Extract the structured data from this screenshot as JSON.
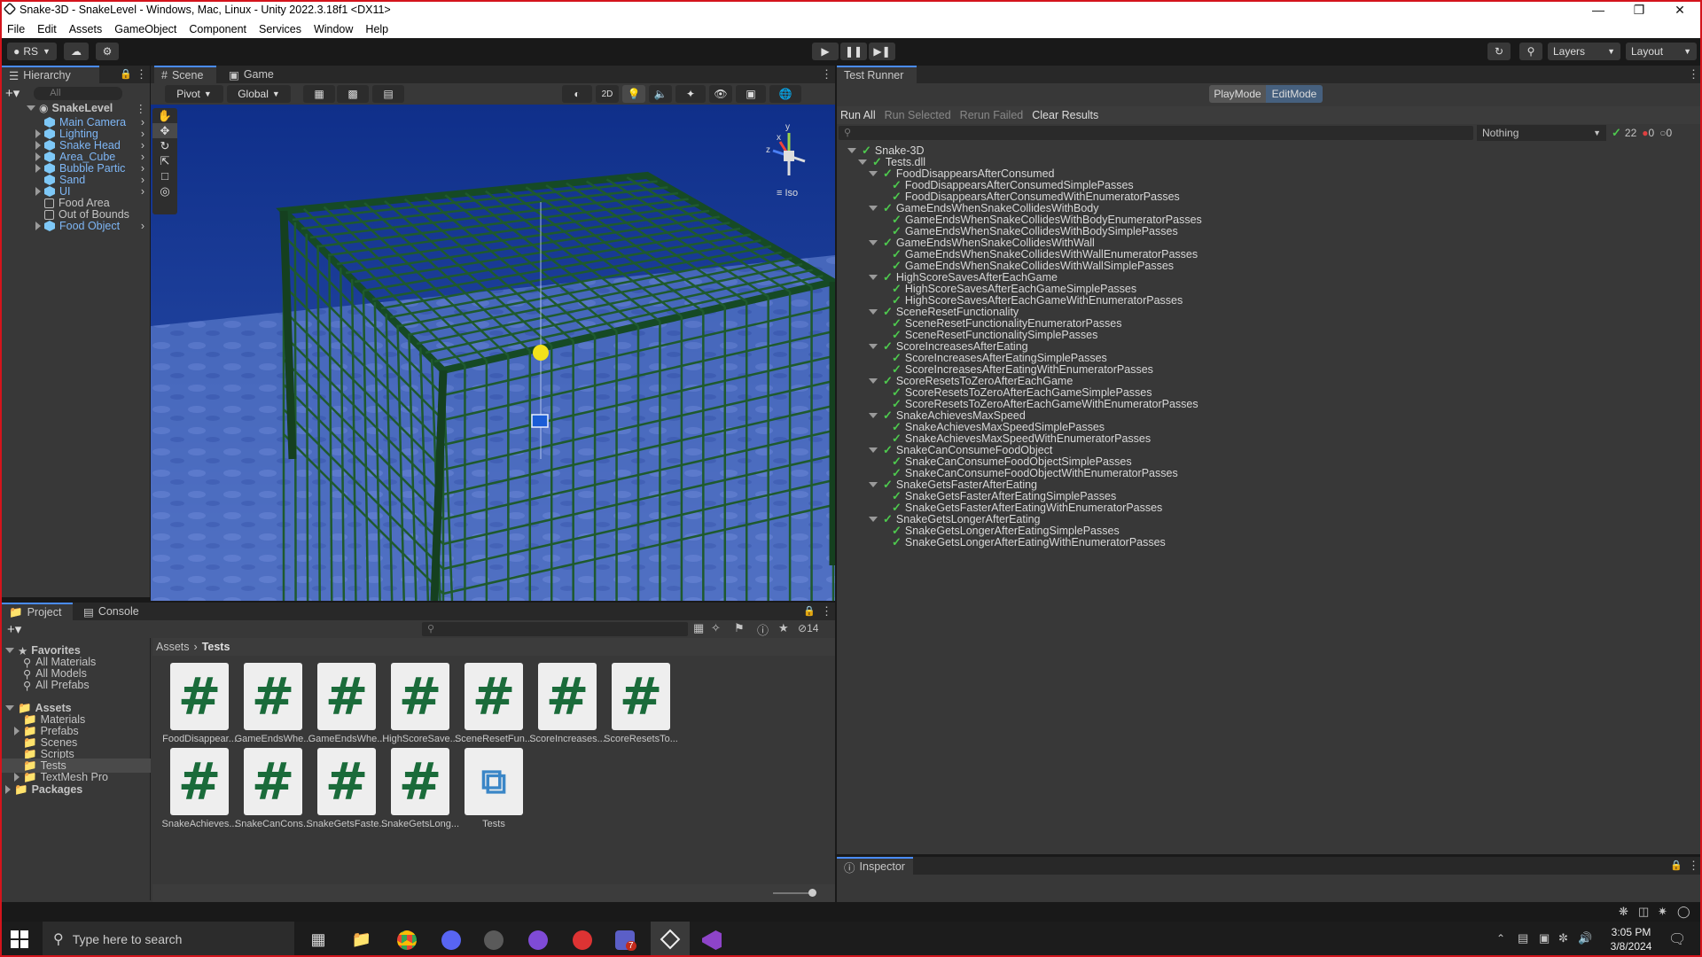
{
  "window": {
    "title": "Snake-3D - SnakeLevel - Windows, Mac, Linux - Unity 2022.3.18f1 <DX11>"
  },
  "menu": [
    "File",
    "Edit",
    "Assets",
    "GameObject",
    "Component",
    "Services",
    "Window",
    "Help"
  ],
  "toolbar": {
    "account": "RS",
    "layers": "Layers",
    "layout": "Layout"
  },
  "hierarchy": {
    "tab": "Hierarchy",
    "search_placeholder": "All",
    "scene": "SnakeLevel",
    "items": [
      {
        "label": "Main Camera",
        "blue": true,
        "expand": false
      },
      {
        "label": "Lighting",
        "blue": true,
        "expand": true
      },
      {
        "label": "Snake Head",
        "blue": true,
        "expand": true
      },
      {
        "label": "Area_Cube",
        "blue": true,
        "expand": true
      },
      {
        "label": "Bubble Partic",
        "blue": true,
        "expand": true
      },
      {
        "label": "Sand",
        "blue": true,
        "expand": false
      },
      {
        "label": "UI",
        "blue": true,
        "expand": true
      },
      {
        "label": "Food Area",
        "blue": false,
        "expand": false
      },
      {
        "label": "Out of Bounds",
        "blue": false,
        "expand": false
      },
      {
        "label": "Food Object",
        "blue": true,
        "expand": true
      }
    ]
  },
  "scene": {
    "tab_scene": "Scene",
    "tab_game": "Game",
    "pivot": "Pivot",
    "global": "Global",
    "mode_2d": "2D",
    "iso": "Iso",
    "gizmo_x": "x",
    "gizmo_y": "y",
    "gizmo_z": "z"
  },
  "test_runner": {
    "tab": "Test Runner",
    "playmode": "PlayMode",
    "editmode": "EditMode",
    "run_all": "Run All",
    "run_selected": "Run Selected",
    "rerun_failed": "Rerun Failed",
    "clear_results": "Clear Results",
    "filter": "Nothing",
    "passed": "22",
    "failed": "0",
    "skipped": "0",
    "root": "Snake-3D",
    "dll": "Tests.dll",
    "groups": [
      {
        "name": "FoodDisappearsAfterConsumed",
        "tests": [
          "FoodDisappearsAfterConsumedSimplePasses",
          "FoodDisappearsAfterConsumedWithEnumeratorPasses"
        ]
      },
      {
        "name": "GameEndsWhenSnakeCollidesWithBody",
        "tests": [
          "GameEndsWhenSnakeCollidesWithBodyEnumeratorPasses",
          "GameEndsWhenSnakeCollidesWithBodySimplePasses"
        ]
      },
      {
        "name": "GameEndsWhenSnakeCollidesWithWall",
        "tests": [
          "GameEndsWhenSnakeCollidesWithWallEnumeratorPasses",
          "GameEndsWhenSnakeCollidesWithWallSimplePasses"
        ]
      },
      {
        "name": "HighScoreSavesAfterEachGame",
        "tests": [
          "HighScoreSavesAfterEachGameSimplePasses",
          "HighScoreSavesAfterEachGameWithEnumeratorPasses"
        ]
      },
      {
        "name": "SceneResetFunctionality",
        "tests": [
          "SceneResetFunctionalityEnumeratorPasses",
          "SceneResetFunctionalitySimplePasses"
        ]
      },
      {
        "name": "ScoreIncreasesAfterEating",
        "tests": [
          "ScoreIncreasesAfterEatingSimplePasses",
          "ScoreIncreasesAfterEatingWithEnumeratorPasses"
        ]
      },
      {
        "name": "ScoreResetsToZeroAfterEachGame",
        "tests": [
          "ScoreResetsToZeroAfterEachGameSimplePasses",
          "ScoreResetsToZeroAfterEachGameWithEnumeratorPasses"
        ]
      },
      {
        "name": "SnakeAchievesMaxSpeed",
        "tests": [
          "SnakeAchievesMaxSpeedSimplePasses",
          "SnakeAchievesMaxSpeedWithEnumeratorPasses"
        ]
      },
      {
        "name": "SnakeCanConsumeFoodObject",
        "tests": [
          "SnakeCanConsumeFoodObjectSimplePasses",
          "SnakeCanConsumeFoodObjectWithEnumeratorPasses"
        ]
      },
      {
        "name": "SnakeGetsFasterAfterEating",
        "tests": [
          "SnakeGetsFasterAfterEatingSimplePasses",
          "SnakeGetsFasterAfterEatingWithEnumeratorPasses"
        ]
      },
      {
        "name": "SnakeGetsLongerAfterEating",
        "tests": [
          "SnakeGetsLongerAfterEatingSimplePasses",
          "SnakeGetsLongerAfterEatingWithEnumeratorPasses"
        ]
      }
    ]
  },
  "inspector": {
    "tab": "Inspector"
  },
  "project": {
    "tab_project": "Project",
    "tab_console": "Console",
    "hidden_count": "14",
    "breadcrumb_root": "Assets",
    "breadcrumb_current": "Tests",
    "favorites": "Favorites",
    "fav_items": [
      "All Materials",
      "All Models",
      "All Prefabs"
    ],
    "assets": "Assets",
    "asset_folders": [
      "Materials",
      "Prefabs",
      "Scenes",
      "Scripts",
      "Tests",
      "TextMesh Pro"
    ],
    "packages": "Packages",
    "files": [
      "FoodDisappear...",
      "GameEndsWhe...",
      "GameEndsWhe...",
      "HighScoreSave...",
      "SceneResetFun...",
      "ScoreIncreases...",
      "ScoreResetsTo...",
      "SnakeAchieves...",
      "SnakeCanCons...",
      "SnakeGetsFaste...",
      "SnakeGetsLong..."
    ],
    "asmdef": "Tests"
  },
  "taskbar": {
    "search_placeholder": "Type here to search",
    "time": "3:05 PM",
    "date": "3/8/2024",
    "teams_badge": "7"
  },
  "colors": {
    "accent": "#4a8cff",
    "pass": "#4ec94e",
    "grid": "#1f5a2e",
    "water": "#1d3f9a"
  }
}
